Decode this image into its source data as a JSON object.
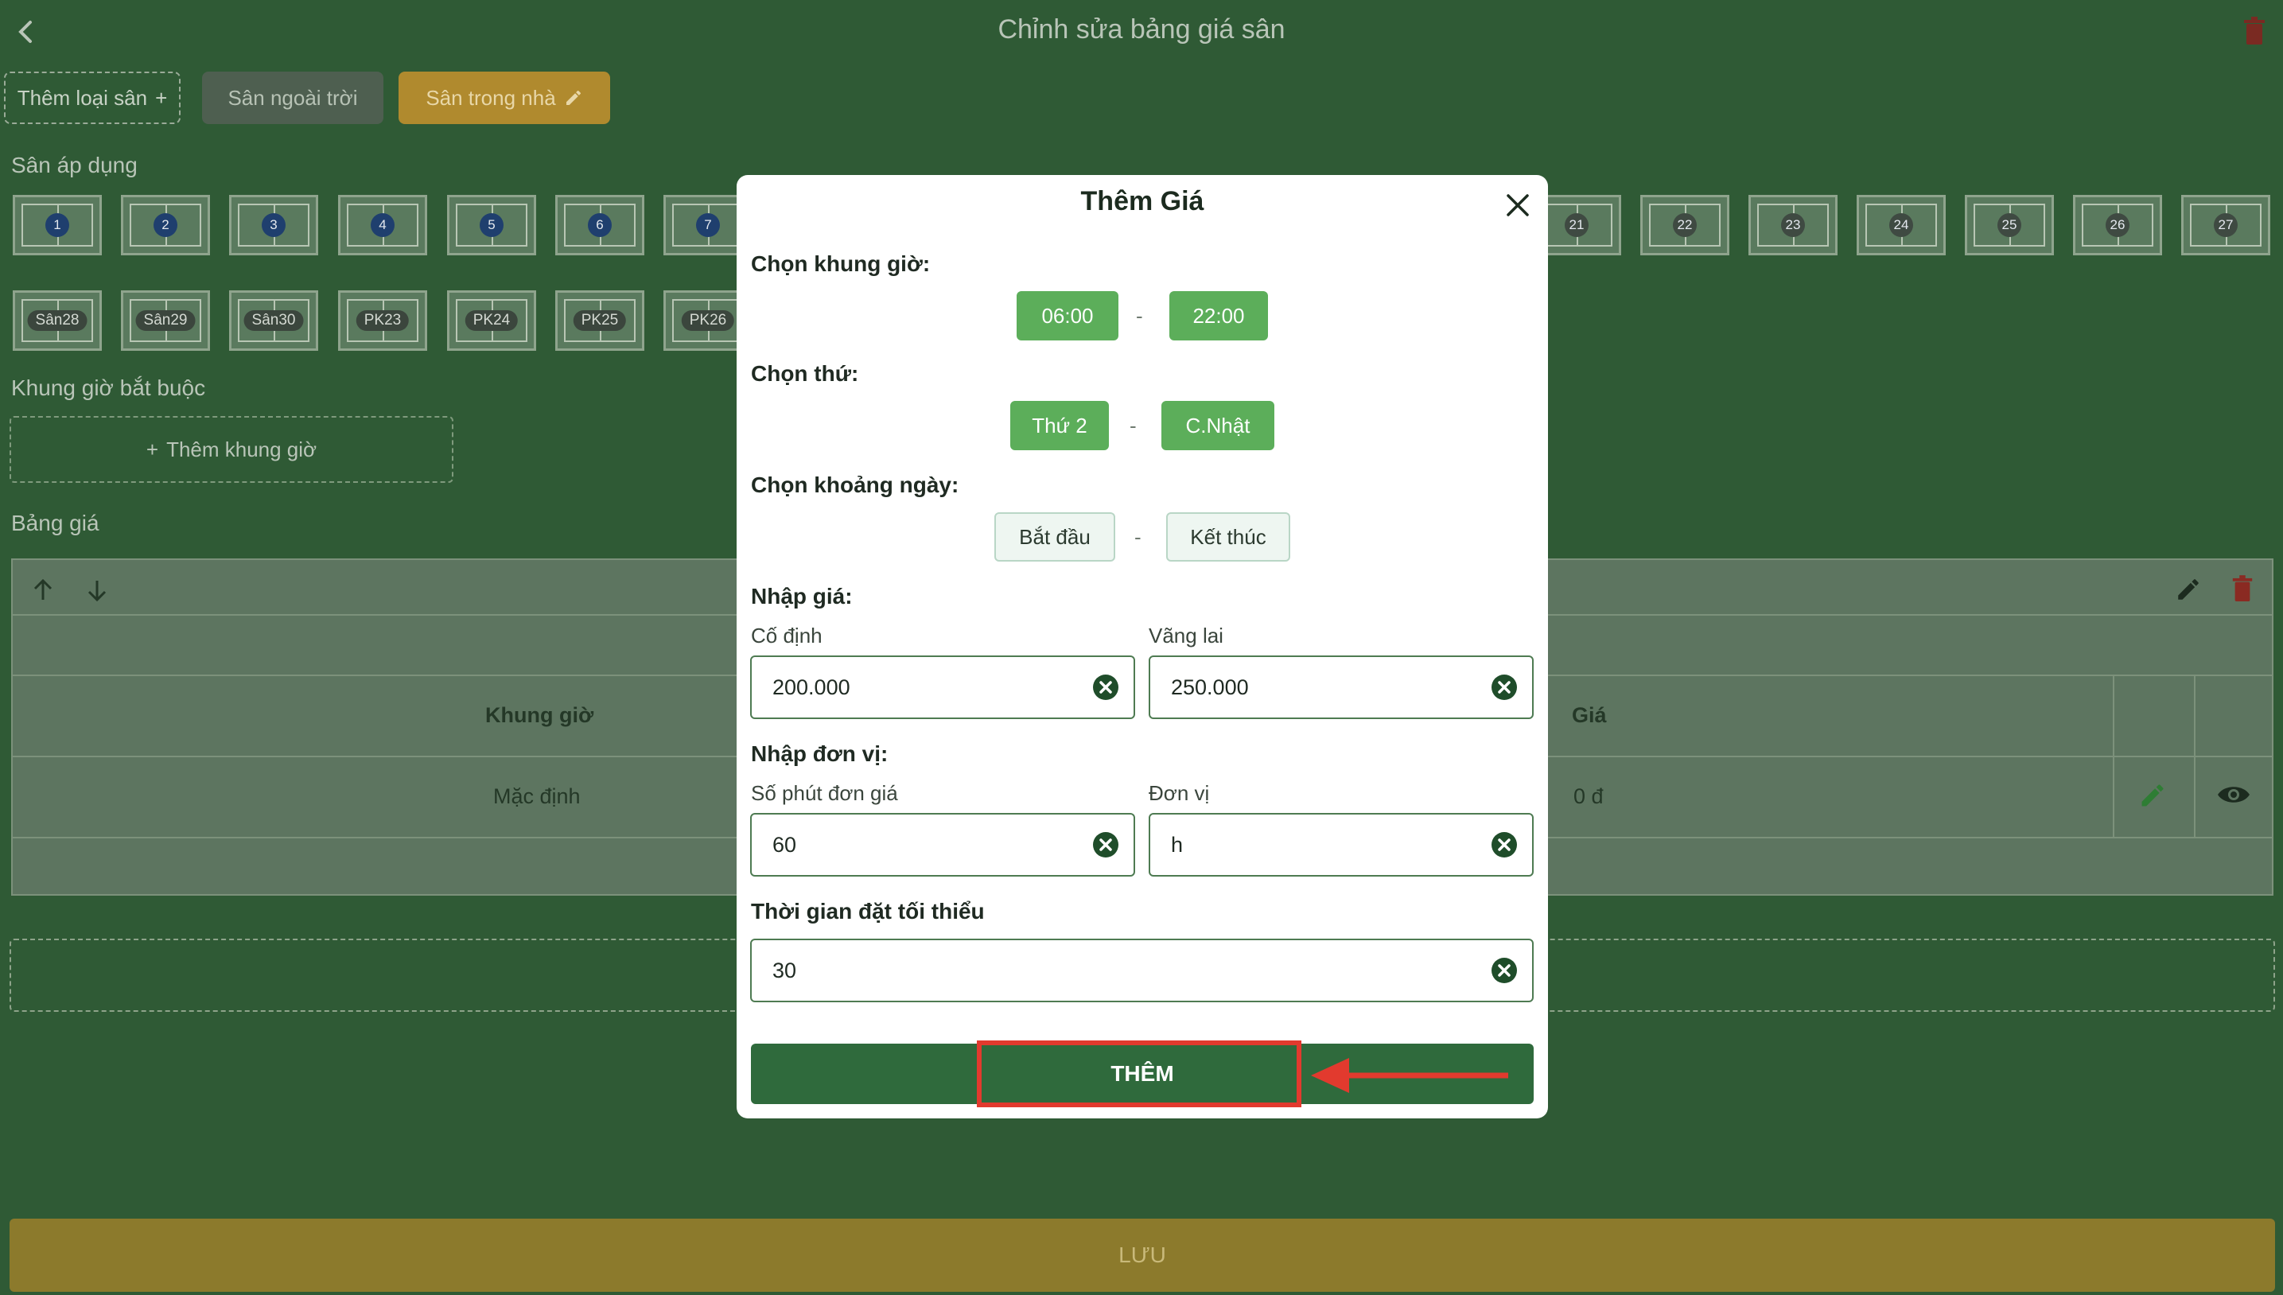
{
  "header": {
    "title": "Chỉnh sửa bảng giá sân"
  },
  "tabs": {
    "add_label": "Thêm loại sân",
    "outdoor_label": "Sân ngoài trời",
    "indoor_label": "Sân trong nhà"
  },
  "sections": {
    "courts_label": "Sân áp dụng",
    "required_slots_label": "Khung giờ bắt buộc",
    "add_slot_label": "Thêm khung giờ",
    "price_table_label": "Bảng giá"
  },
  "courts_row1": [
    "1",
    "2",
    "3",
    "4",
    "5",
    "6",
    "7",
    "21",
    "22",
    "23",
    "24",
    "25",
    "26",
    "27"
  ],
  "courts_row2": [
    "Sân28",
    "Sân29",
    "Sân30",
    "PK23",
    "PK24",
    "PK25",
    "PK26"
  ],
  "price_table": {
    "headers": {
      "time_slot": "Khung giờ",
      "price": "Giá"
    },
    "row": {
      "time_slot": "Mặc định",
      "price": "0 đ"
    }
  },
  "save_label": "LƯU",
  "modal": {
    "title": "Thêm Giá",
    "time_label": "Chọn khung giờ:",
    "time_start": "06:00",
    "time_end": "22:00",
    "day_label": "Chọn thứ:",
    "day_start": "Thứ 2",
    "day_end": "C.Nhật",
    "date_range_label": "Chọn khoảng ngày:",
    "date_start": "Bắt đầu",
    "date_end": "Kết thúc",
    "price_label": "Nhập giá:",
    "fixed_label": "Cố định",
    "fixed_value": "200.000",
    "walkin_label": "Vãng lai",
    "walkin_value": "250.000",
    "unit_section_label": "Nhập đơn vị:",
    "minutes_label": "Số phút đơn giá",
    "minutes_value": "60",
    "unit_label": "Đơn vị",
    "unit_value": "h",
    "min_time_label": "Thời gian đặt tối thiểu",
    "min_time_value": "30",
    "submit_label": "THÊM",
    "separator": "-"
  },
  "colors": {
    "background": "#2f5a35",
    "accent_green": "#5cae5a",
    "submit_green": "#2f6a3c",
    "highlight_red": "#e23a2e",
    "indoor_tab": "#b08a2e"
  }
}
